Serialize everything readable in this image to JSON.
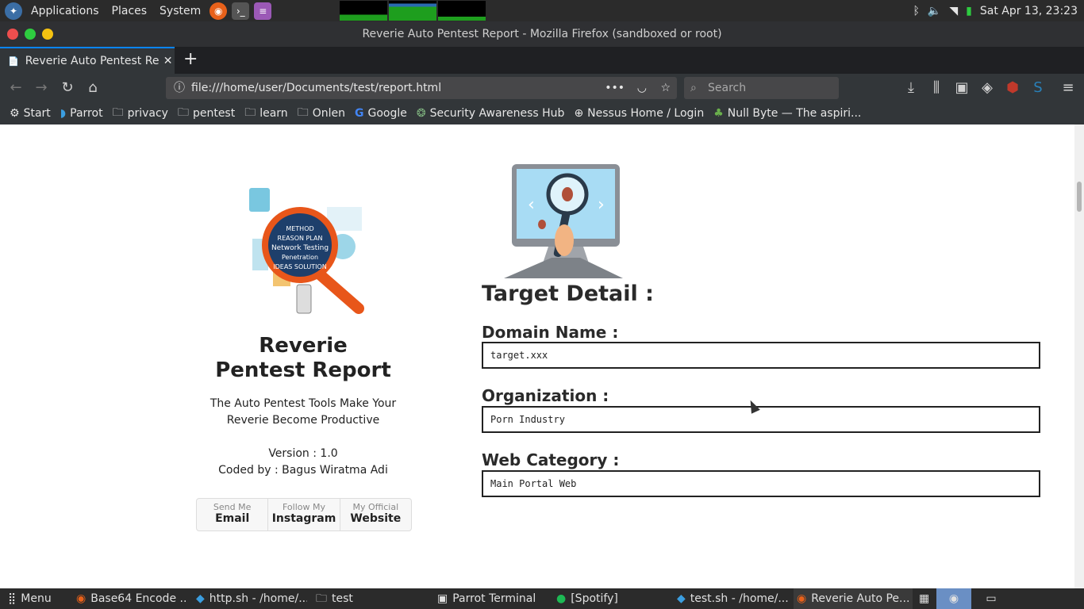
{
  "topbar": {
    "menus": [
      "Applications",
      "Places",
      "System"
    ],
    "datetime": "Sat Apr 13, 23:23"
  },
  "window": {
    "title": "Reverie Auto Pentest Report - Mozilla Firefox (sandboxed or root)"
  },
  "tab": {
    "label": "Reverie Auto Pentest Rep",
    "new_tab": "+"
  },
  "nav": {
    "url": "file:///home/user/Documents/test/report.html",
    "search_placeholder": "Search"
  },
  "bookmarks": [
    "Start",
    "Parrot",
    "privacy",
    "pentest",
    "learn",
    "Onlen",
    "Google",
    "Security Awareness Hub",
    "Nessus Home / Login",
    "Null Byte — The aspiri..."
  ],
  "report": {
    "title_line1": "Reverie",
    "title_line2": "Pentest Report",
    "tagline_line1": "The Auto Pentest Tools Make Your",
    "tagline_line2": "Reverie Become Productive",
    "version": "Version : 1.0",
    "coded_by": "Coded by : Bagus Wiratma Adi",
    "buttons": [
      {
        "small": "Send Me",
        "big": "Email"
      },
      {
        "small": "Follow My",
        "big": "Instagram"
      },
      {
        "small": "My Official",
        "big": "Website"
      }
    ],
    "target_heading": "Target Detail :",
    "domain_label": "Domain Name :",
    "domain_value": "target.xxx",
    "org_label": "Organization :",
    "org_value": "Porn Industry",
    "category_label": "Web Category :",
    "category_value": "Main Portal Web"
  },
  "taskbar": {
    "menu": "Menu",
    "tasks": [
      "Base64 Encode ...",
      "http.sh - /home/...",
      "test",
      "Parrot Terminal",
      "[Spotify]",
      "test.sh - /home/...",
      "Reverie Auto Pe..."
    ]
  }
}
